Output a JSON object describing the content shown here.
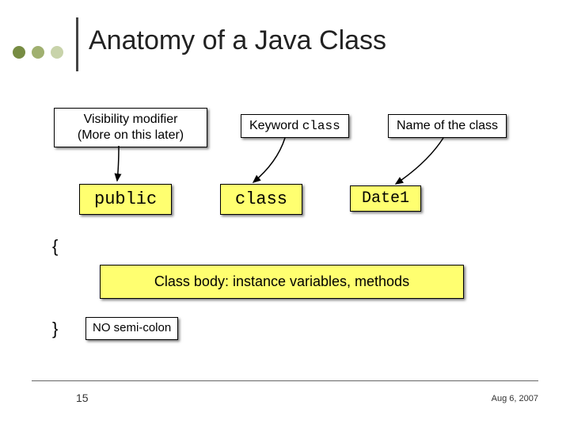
{
  "title": "Anatomy of a Java Class",
  "labels": {
    "visibility_line1": "Visibility modifier",
    "visibility_line2": "(More on this later)",
    "keyword_prefix": "Keyword ",
    "keyword_code": "class",
    "name_of_class": "Name of the class"
  },
  "code": {
    "public": "public",
    "class": "class",
    "date1": "Date1"
  },
  "braces": {
    "open": "{",
    "close": "}"
  },
  "body_text": "Class body: instance variables, methods",
  "no_semicolon": "NO semi-colon",
  "footer": {
    "page": "15",
    "date": "Aug 6, 2007"
  }
}
